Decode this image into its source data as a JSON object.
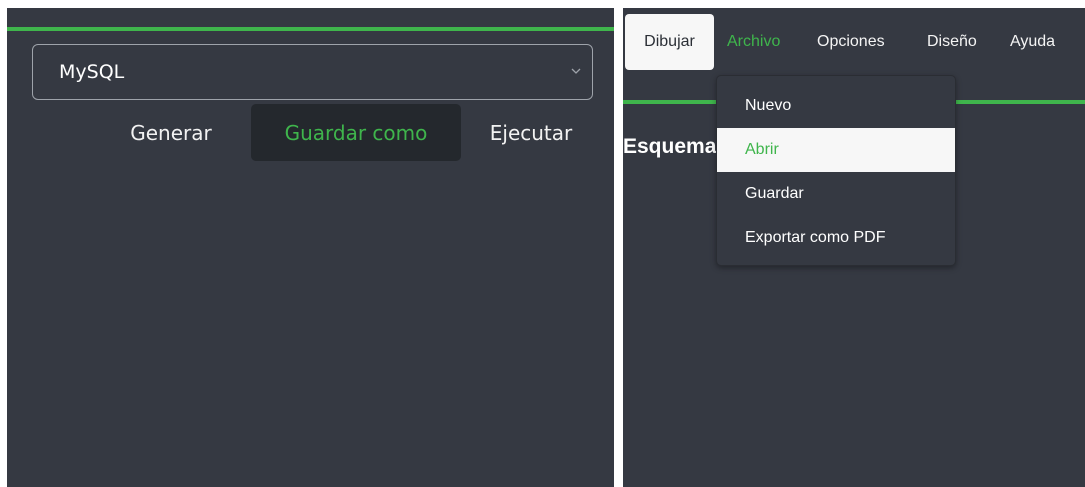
{
  "left_panel": {
    "database_select": {
      "value": "MySQL",
      "icon": "chevron-down-icon"
    },
    "actions": {
      "generar": "Generar",
      "guardar_como": "Guardar como",
      "ejecutar": "Ejecutar"
    }
  },
  "right_panel": {
    "menubar": {
      "dibujar": "Dibujar",
      "archivo": "Archivo",
      "opciones": "Opciones",
      "diseno": "Diseño",
      "ayuda": "Ayuda"
    },
    "archivo_menu": {
      "items": [
        "Nuevo",
        "Abrir",
        "Guardar",
        "Exportar como PDF"
      ],
      "highlighted": "Abrir"
    },
    "heading": "Esquema"
  },
  "colors": {
    "panel_bg": "#353942",
    "accent_green": "#3fb54c",
    "active_button_bg": "#24282d",
    "menu_highlight_bg": "#f7f7f7"
  }
}
